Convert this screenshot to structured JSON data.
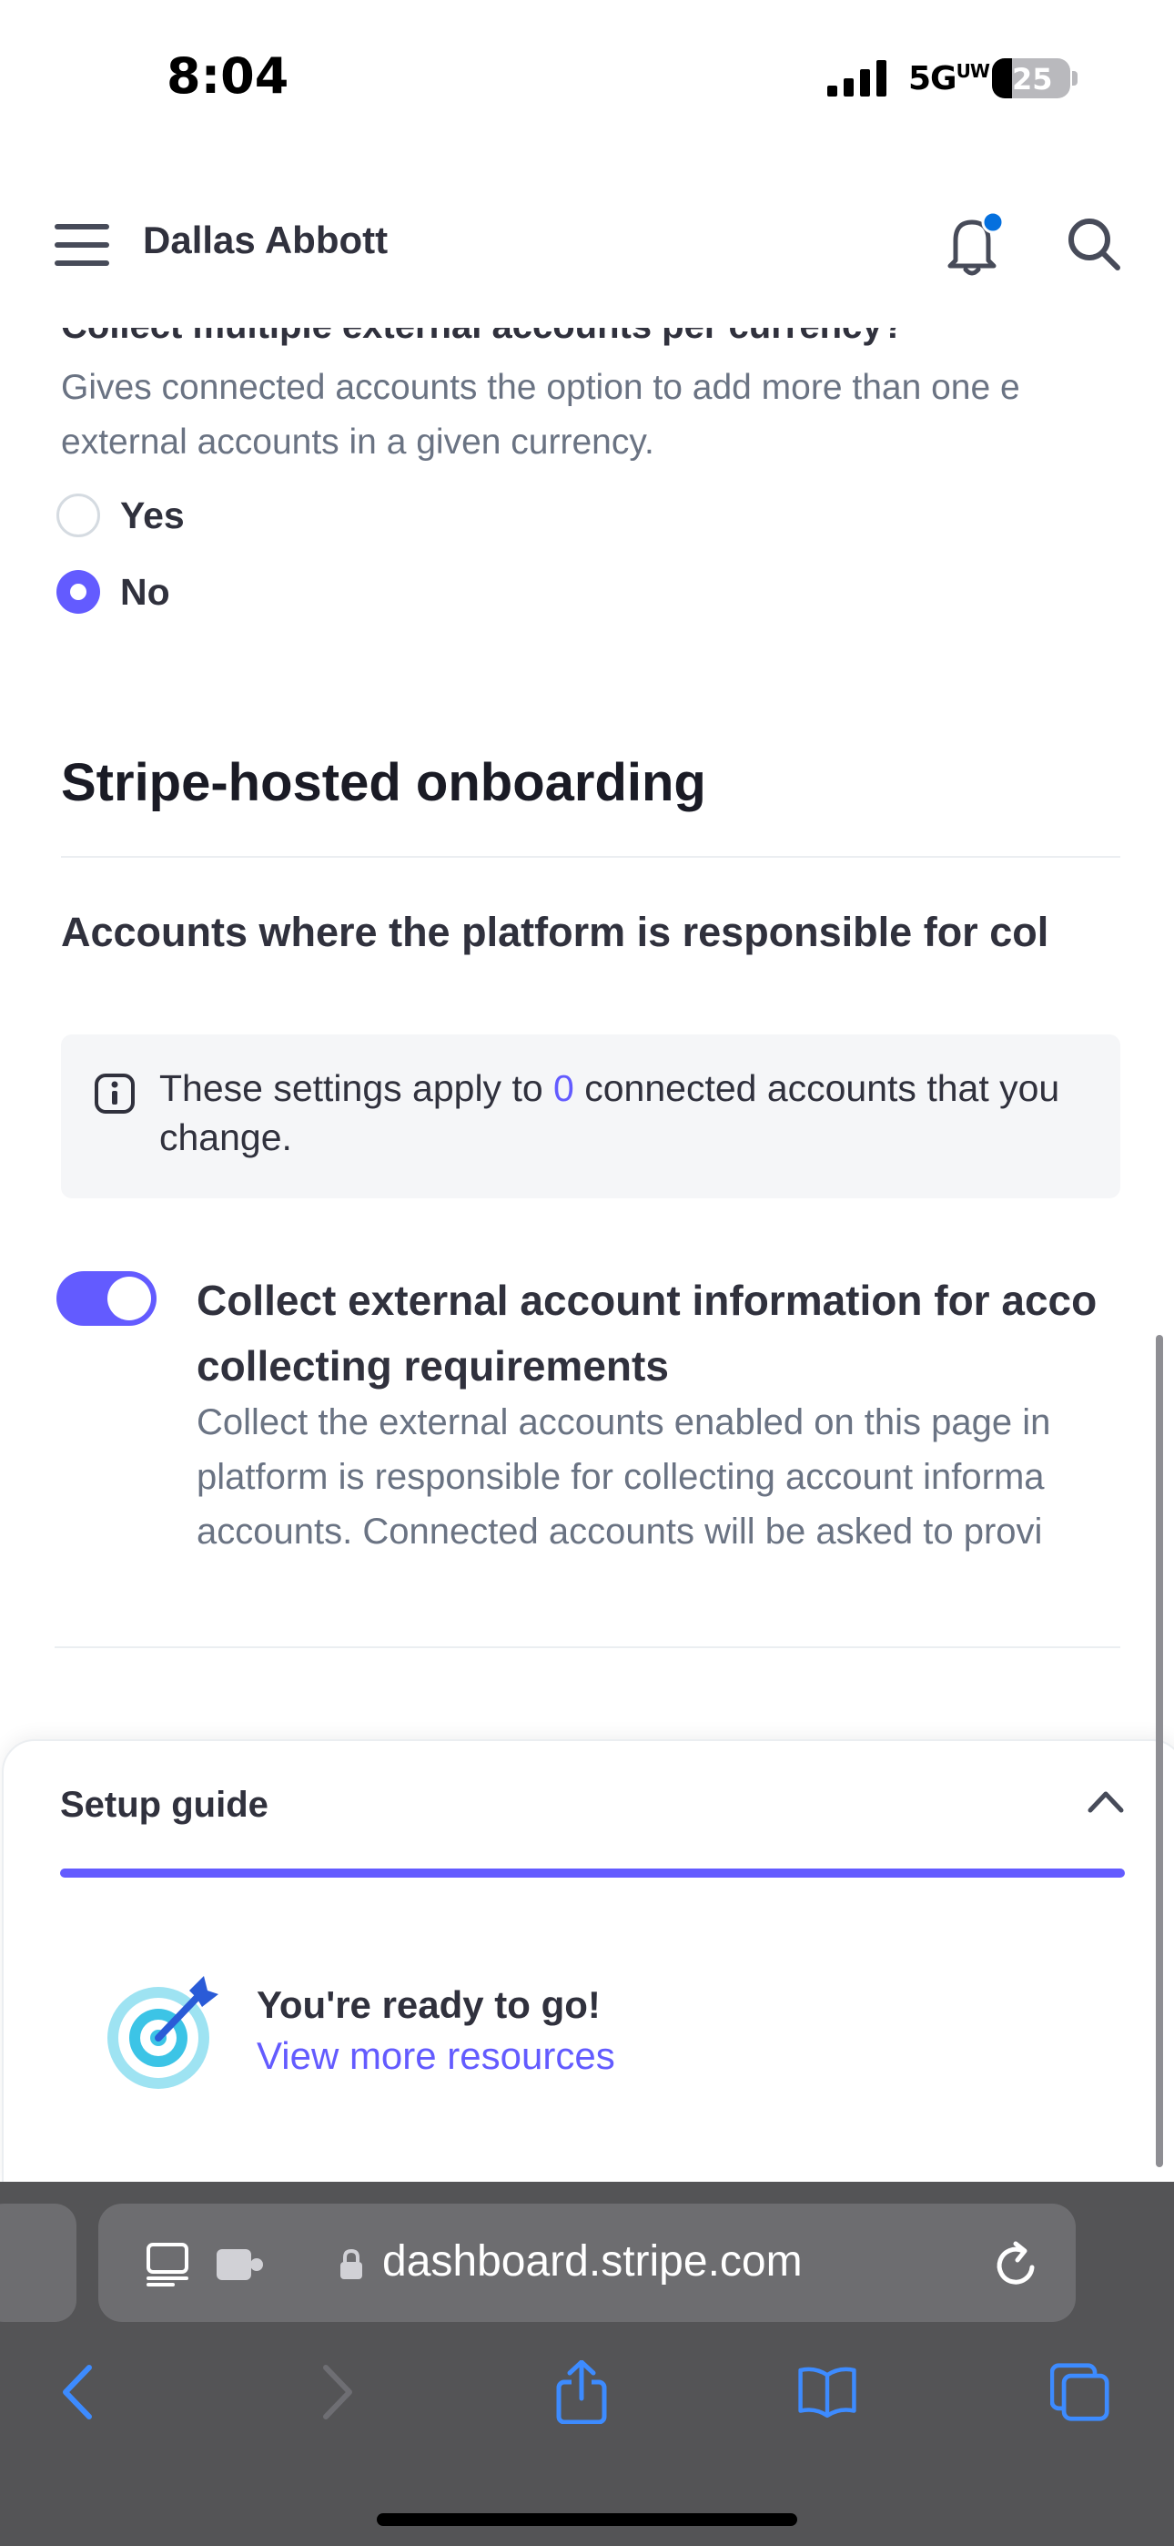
{
  "status_bar": {
    "time": "8:04",
    "network": "5G",
    "network_badge": "UW",
    "battery": "25"
  },
  "header": {
    "account_name": "Dallas Abbott",
    "icons": [
      "menu-icon",
      "bell-icon",
      "search-icon"
    ],
    "notification_dot_color": "#0570de"
  },
  "question": {
    "title": "Collect multiple external accounts per currency?",
    "description_line1": "Gives connected accounts the option to add more than one e",
    "description_line2": "external accounts in a given currency.",
    "options": [
      {
        "label": "Yes",
        "selected": false
      },
      {
        "label": "No",
        "selected": true
      }
    ]
  },
  "onboarding": {
    "section_title": "Stripe-hosted onboarding",
    "subtitle": "Accounts where the platform is responsible for col",
    "info": {
      "before": "These settings apply to ",
      "count": "0",
      "after": " connected accounts that you",
      "line2": "change."
    },
    "toggle": {
      "on": true,
      "title_line1": "Collect external account information for acco",
      "title_line2": "collecting requirements",
      "desc_line1": "Collect the external accounts enabled on this page in",
      "desc_line2": "platform is responsible for collecting account informa",
      "desc_line3": "accounts. Connected accounts will be asked to provi"
    }
  },
  "setup_guide": {
    "title": "Setup guide",
    "progress_fraction": 1.0,
    "ready_text": "You're ready to go!",
    "link_text": "View more resources"
  },
  "browser": {
    "url": "dashboard.stripe.com",
    "toolbar_icons": [
      "back-icon",
      "forward-icon",
      "share-icon",
      "bookmarks-icon",
      "tabs-icon"
    ]
  },
  "colors": {
    "accent": "#635bff",
    "text": "#30313d",
    "muted": "#6a7383",
    "safari_bar": "#545456"
  }
}
